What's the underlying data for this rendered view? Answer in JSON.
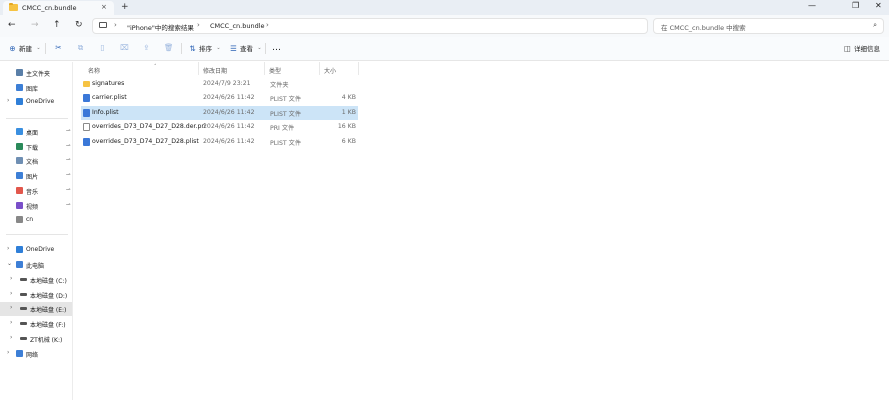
{
  "tab": {
    "title": "CMCC_cn.bundle",
    "close": "×",
    "new_tab": "+"
  },
  "window_controls": {
    "minimize": "—",
    "maximize": "❐",
    "close": "✕"
  },
  "nav": {
    "back": "←",
    "forward": "→",
    "up": "↑",
    "refresh": "↻"
  },
  "address": {
    "breadcrumbs": [
      "\"iPhone\"中的搜索结果",
      "CMCC_cn.bundle"
    ],
    "separator": "›"
  },
  "search": {
    "placeholder": "在 CMCC_cn.bundle 中搜索",
    "icon": "⌕"
  },
  "toolbar": {
    "new_label": "新建",
    "sort_label": "排序",
    "view_label": "查看",
    "more_label": "…",
    "details_label": "详细信息"
  },
  "sidebar": {
    "quick": [
      {
        "label": "主文件夹",
        "icon": "home-icon",
        "color": "#5a7fa8"
      },
      {
        "label": "图库",
        "icon": "gallery-icon",
        "color": "#3d7fd6"
      },
      {
        "label": "OneDrive",
        "icon": "cloud-icon",
        "color": "#2f7fd8"
      }
    ],
    "pinned": [
      {
        "label": "桌面",
        "icon": "desktop-icon",
        "color": "#3a8fe0"
      },
      {
        "label": "下载",
        "icon": "download-icon",
        "color": "#2a8a5a"
      },
      {
        "label": "文档",
        "icon": "documents-icon",
        "color": "#6f8fb3"
      },
      {
        "label": "图片",
        "icon": "pictures-icon",
        "color": "#3d7fd6"
      },
      {
        "label": "音乐",
        "icon": "music-icon",
        "color": "#e2574c"
      },
      {
        "label": "视频",
        "icon": "videos-icon",
        "color": "#7a4fc9"
      },
      {
        "label": "cn",
        "icon": "search-folder-icon",
        "color": "#888888"
      }
    ],
    "tree": [
      {
        "label": "OneDrive",
        "icon": "cloud-icon",
        "color": "#2f7fd8",
        "chev": "›"
      },
      {
        "label": "此电脑",
        "icon": "computer-icon",
        "color": "#3d7fd6",
        "chev": "⌄"
      },
      {
        "label": "本地磁盘 (C:)",
        "icon": "drive-icon",
        "color": "#555555",
        "chev": "›"
      },
      {
        "label": "本地磁盘 (D:)",
        "icon": "drive-icon",
        "color": "#555555",
        "chev": "›"
      },
      {
        "label": "本地磁盘 (E:)",
        "icon": "drive-icon",
        "color": "#555555",
        "chev": "›"
      },
      {
        "label": "本地磁盘 (F:)",
        "icon": "drive-icon",
        "color": "#555555",
        "chev": "›"
      },
      {
        "label": "ZT机械 (K:)",
        "icon": "drive-icon",
        "color": "#555555",
        "chev": "›"
      },
      {
        "label": "网络",
        "icon": "network-icon",
        "color": "#3d7fd6",
        "chev": "›"
      }
    ],
    "pin_glyph": "📌"
  },
  "columns": {
    "name": "名称",
    "date": "修改日期",
    "type": "类型",
    "size": "大小",
    "sort_indicator": "˄"
  },
  "files": [
    {
      "name": "signatures",
      "date": "2024/7/9 23:21",
      "type": "文件夹",
      "size": "",
      "icon": "folder-icon"
    },
    {
      "name": "carrier.plist",
      "date": "2024/6/26 11:42",
      "type": "PLIST 文件",
      "size": "4 KB",
      "icon": "plist-icon"
    },
    {
      "name": "Info.plist",
      "date": "2024/6/26 11:42",
      "type": "PLIST 文件",
      "size": "1 KB",
      "icon": "plist-icon"
    },
    {
      "name": "overrides_D73_D74_D27_D28.der.pri",
      "date": "2024/6/26 11:42",
      "type": "PRI 文件",
      "size": "16 KB",
      "icon": "document-icon"
    },
    {
      "name": "overrides_D73_D74_D27_D28.plist",
      "date": "2024/6/26 11:42",
      "type": "PLIST 文件",
      "size": "6 KB",
      "icon": "plist-icon"
    }
  ],
  "selected_row": 2
}
